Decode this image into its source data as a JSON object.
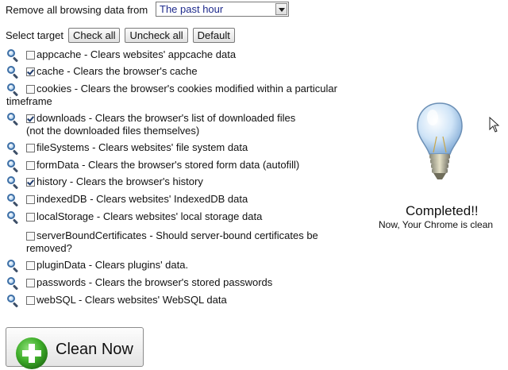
{
  "header": {
    "label": "Remove all browsing data from",
    "select_value": "The past hour"
  },
  "targets": {
    "label": "Select target",
    "check_all": "Check all",
    "uncheck_all": "Uncheck all",
    "default": "Default"
  },
  "items": [
    {
      "text": "appcache - Clears websites' appcache data",
      "checked": false,
      "icon": "magnifier-icon"
    },
    {
      "text": "cache - Clears the browser's cache",
      "checked": true,
      "icon": "magnifier-icon"
    },
    {
      "line1": "cookies - Clears the browser's cookies modified within a particular",
      "line2": "timeframe",
      "checked": false,
      "icon": "magnifier-icon"
    },
    {
      "line1": "downloads - Clears the browser's list of downloaded files",
      "line2": "(not the downloaded files themselves)",
      "checked": true,
      "icon": "magnifier-icon"
    },
    {
      "text": "fileSystems - Clears websites' file system data",
      "checked": false,
      "icon": "magnifier-icon"
    },
    {
      "text": "formData - Clears the browser's stored form data (autofill)",
      "checked": false,
      "icon": "magnifier-icon"
    },
    {
      "text": "history - Clears the browser's history",
      "checked": true,
      "icon": "magnifier-icon"
    },
    {
      "text": "indexedDB - Clears websites' IndexedDB data",
      "checked": false,
      "icon": "magnifier-icon"
    },
    {
      "text": "localStorage - Clears websites' local storage data",
      "checked": false,
      "icon": "magnifier-icon"
    },
    {
      "line1": "serverBoundCertificates - Should server-bound certificates be",
      "line2": "removed?",
      "checked": false,
      "icon": "none"
    },
    {
      "text": "pluginData - Clears plugins' data.",
      "checked": false,
      "icon": "magnifier-icon"
    },
    {
      "text": "passwords - Clears the browser's stored passwords",
      "checked": false,
      "icon": "magnifier-icon"
    },
    {
      "text": "webSQL - Clears websites' WebSQL data",
      "checked": false,
      "icon": "magnifier-icon"
    }
  ],
  "status": {
    "title": "Completed!!",
    "subtitle": "Now, Your Chrome is clean"
  },
  "action": {
    "label": "Clean Now"
  },
  "colors": {
    "accent_green": "#3fae2a",
    "select_text": "#1e2a8c",
    "magnifier": "#3d6fa6"
  }
}
